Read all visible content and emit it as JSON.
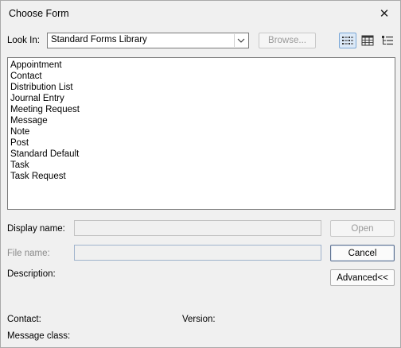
{
  "window": {
    "title": "Choose Form"
  },
  "look_in": {
    "label": "Look In:",
    "value": "Standard Forms Library",
    "browse_label": "Browse..."
  },
  "view_buttons": [
    {
      "icon": "list-view-icon",
      "active": true
    },
    {
      "icon": "details-view-icon",
      "active": false
    },
    {
      "icon": "tree-view-icon",
      "active": false
    }
  ],
  "forms": [
    "Appointment",
    "Contact",
    "Distribution List",
    "Journal Entry",
    "Meeting Request",
    "Message",
    "Note",
    "Post",
    "Standard Default",
    "Task",
    "Task Request"
  ],
  "fields": {
    "display_name_label": "Display name:",
    "display_name_value": "",
    "file_name_label": "File name:",
    "file_name_value": "",
    "description_label": "Description:",
    "contact_label": "Contact:",
    "version_label": "Version:",
    "message_class_label": "Message class:"
  },
  "buttons": {
    "open_label": "Open",
    "cancel_label": "Cancel",
    "advanced_label": "Advanced<<"
  }
}
